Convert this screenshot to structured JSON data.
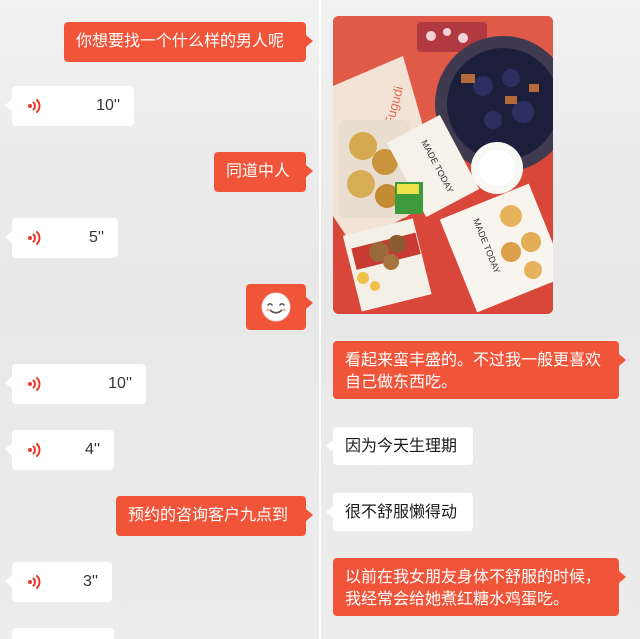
{
  "left_messages": [
    {
      "type": "text",
      "direction": "outgoing",
      "text": "你想要找一个什么样的男人呢"
    },
    {
      "type": "voice",
      "direction": "incoming",
      "duration": "10''",
      "icon": "voice-wave-icon"
    },
    {
      "type": "text",
      "direction": "outgoing",
      "text": "同道中人"
    },
    {
      "type": "voice",
      "direction": "incoming",
      "duration": "5''",
      "icon": "voice-wave-icon"
    },
    {
      "type": "emoji",
      "direction": "outgoing",
      "emoji": "smile-face-emoji"
    },
    {
      "type": "voice",
      "direction": "incoming",
      "duration": "10''",
      "icon": "voice-wave-icon"
    },
    {
      "type": "voice",
      "direction": "incoming",
      "duration": "4''",
      "icon": "voice-wave-icon"
    },
    {
      "type": "text",
      "direction": "outgoing",
      "text": "预约的咨询客户九点到"
    },
    {
      "type": "voice",
      "direction": "incoming",
      "duration": "3''",
      "icon": "voice-wave-icon"
    }
  ],
  "right_messages": [
    {
      "type": "image",
      "direction": "incoming",
      "image": "food-photo",
      "photo_texts": [
        "Fugudi",
        "MADE TODAY",
        "MADE TODAY"
      ]
    },
    {
      "type": "text",
      "direction": "outgoing",
      "text": "看起来蛮丰盛的。不过我一般更喜欢自己做东西吃。"
    },
    {
      "type": "text",
      "direction": "incoming",
      "text": "因为今天生理期"
    },
    {
      "type": "text",
      "direction": "incoming",
      "text": "很不舒服懒得动"
    },
    {
      "type": "text",
      "direction": "outgoing",
      "text": "以前在我女朋友身体不舒服的时候，我经常会给她煮红糖水鸡蛋吃。"
    }
  ],
  "colors": {
    "outgoing_bubble": "#f0553a",
    "incoming_bubble": "#ffffff",
    "voice_icon": "#e8382a",
    "background": "#ececec"
  }
}
